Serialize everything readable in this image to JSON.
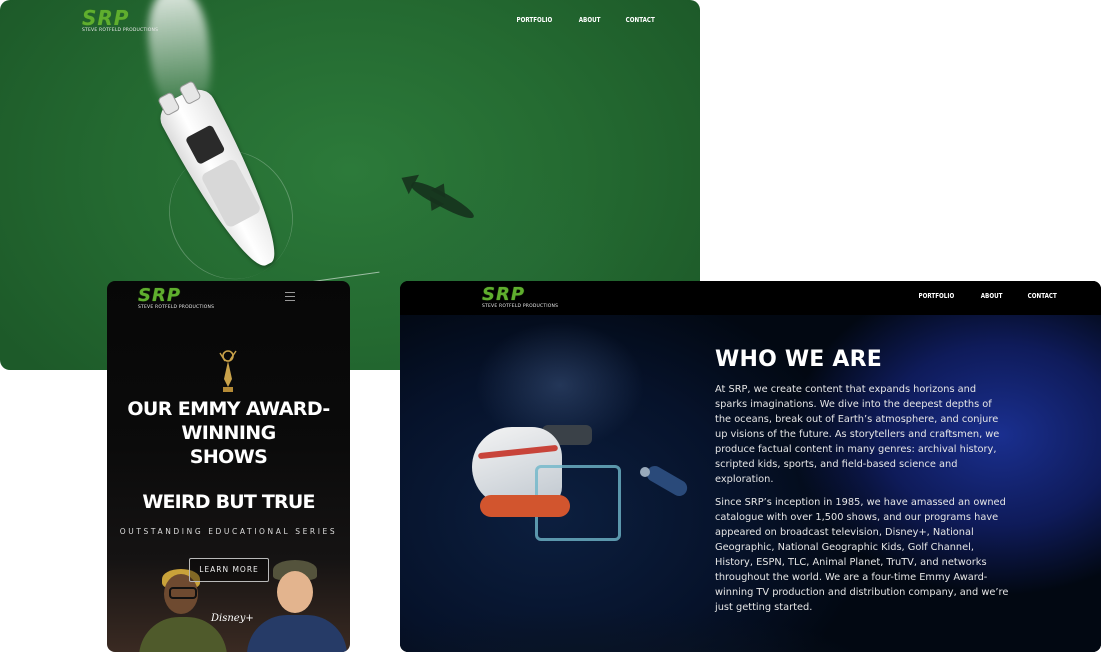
{
  "brand": {
    "logo": "SRP",
    "tagline": "STEVE ROTFELD PRODUCTIONS",
    "logo_color": "#5fae2e"
  },
  "nav": {
    "items": [
      "PORTFOLIO",
      "ABOUT",
      "CONTACT"
    ]
  },
  "mobile": {
    "icon": "emmy-award-icon",
    "heading_line1": "OUR EMMY AWARD-WINNING",
    "heading_line2": "SHOWS",
    "show_title": "WEIRD BUT TRUE",
    "show_subtitle": "OUTSTANDING EDUCATIONAL SERIES",
    "cta_label": "LEARN MORE",
    "network": "Disney+"
  },
  "about": {
    "heading": "WHO WE ARE",
    "paragraph1": "At SRP, we create content that expands horizons and sparks imaginations. We dive into the deepest depths of the oceans, break out of Earth’s atmosphere, and conjure up visions of the future. As storytellers and craftsmen, we produce factual content in many genres: archival history, scripted kids, sports, and field-based science and exploration.",
    "paragraph2": "Since SRP’s inception in 1985, we have amassed an owned catalogue with over 1,500 shows, and our programs have appeared on broadcast television, Disney+, National Geographic, National Geographic Kids, Golf Channel, History, ESPN, TLC, Animal Planet, TruTV, and networks throughout the world. We are a four-time Emmy Award-winning TV production and distribution company, and we’re just getting started."
  }
}
